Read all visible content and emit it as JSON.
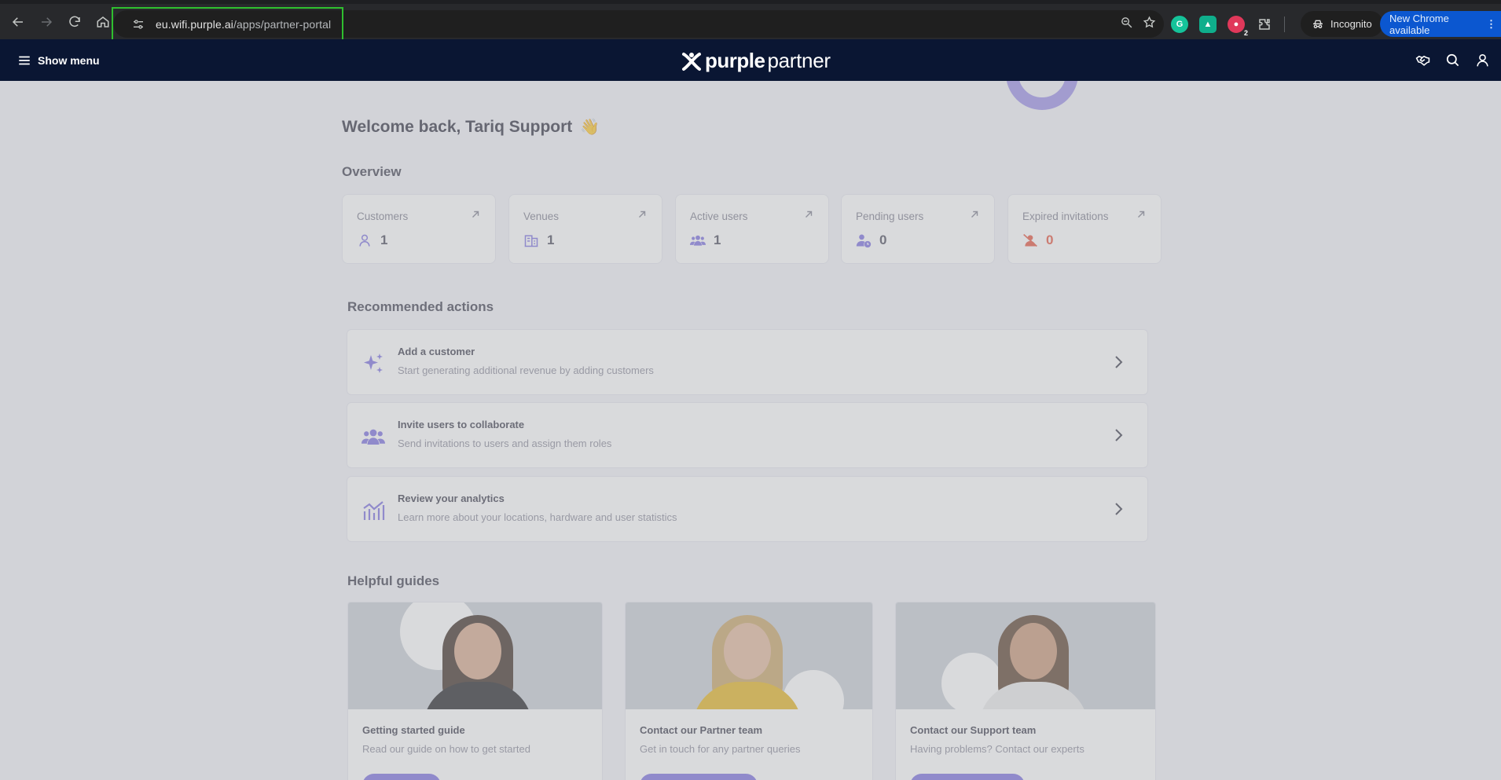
{
  "browser": {
    "url_host": "eu.wifi.purple.ai",
    "url_path": "/apps/partner-portal",
    "incognito_label": "Incognito",
    "update_label": "New Chrome available",
    "extension_badge": "2"
  },
  "header": {
    "menu_label": "Show menu",
    "brand_bold": "purple",
    "brand_light": "partner"
  },
  "main": {
    "welcome": "Welcome back, Tariq Support",
    "wave_emoji": "👋",
    "overview_title": "Overview",
    "stats": [
      {
        "label": "Customers",
        "value": "1",
        "icon": "user-icon"
      },
      {
        "label": "Venues",
        "value": "1",
        "icon": "building-icon"
      },
      {
        "label": "Active users",
        "value": "1",
        "icon": "users-icon"
      },
      {
        "label": "Pending users",
        "value": "0",
        "icon": "user-clock-icon"
      },
      {
        "label": "Expired invitations",
        "value": "0",
        "icon": "user-slash-icon"
      }
    ],
    "recommended_title": "Recommended actions",
    "actions": [
      {
        "title": "Add a customer",
        "subtitle": "Start generating additional revenue by adding customers",
        "icon": "sparkles-icon"
      },
      {
        "title": "Invite users to collaborate",
        "subtitle": "Send invitations to users and assign them roles",
        "icon": "users-icon"
      },
      {
        "title": "Review your analytics",
        "subtitle": "Learn more about your locations, hardware and user statistics",
        "icon": "chart-icon"
      }
    ],
    "guides_title": "Helpful guides",
    "guides": [
      {
        "title": "Getting started guide",
        "subtitle": "Read our guide on how to get started"
      },
      {
        "title": "Contact our Partner team",
        "subtitle": "Get in touch for any partner queries"
      },
      {
        "title": "Contact our Support team",
        "subtitle": "Having problems? Contact our experts"
      }
    ]
  },
  "colors": {
    "header_bg": "#0a1633",
    "accent": "#7b6ee0",
    "alert": "#e5533d",
    "highlight": "#2fbf2f"
  }
}
